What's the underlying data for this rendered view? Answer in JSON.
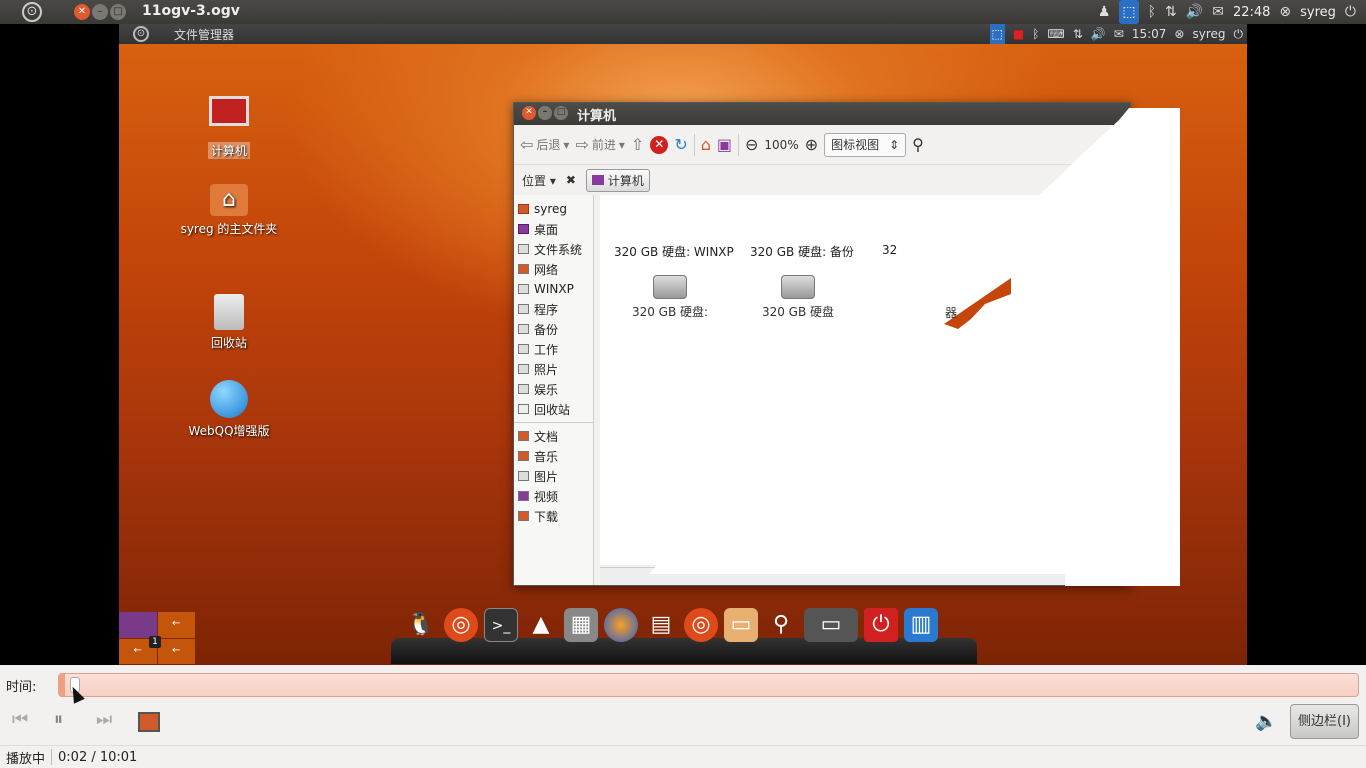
{
  "outer_panel": {
    "title": "11ogv-3.ogv",
    "time": "22:48",
    "user": "syreg"
  },
  "inner_panel": {
    "title": "文件管理器",
    "time": "15:07",
    "user": "syreg"
  },
  "desktop_icons": [
    {
      "label": "计算机",
      "icon": "computer-icon"
    },
    {
      "label": "syreg 的主文件夹",
      "icon": "home-folder-icon"
    },
    {
      "label": "回收站",
      "icon": "trash-icon"
    },
    {
      "label": "WebQQ增强版",
      "icon": "webqq-icon"
    }
  ],
  "file_manager": {
    "title": "计算机",
    "toolbar": {
      "back": "后退",
      "forward": "前进",
      "zoom": "100%",
      "view": "图标视图"
    },
    "location_label": "位置",
    "breadcrumb": "计算机",
    "sidebar": [
      "syreg",
      "桌面",
      "文件系统",
      "网络",
      "WINXP",
      "程序",
      "备份",
      "工作",
      "照片",
      "娱乐",
      "回收站"
    ],
    "sidebar_bookmarks": [
      "文档",
      "音乐",
      "图片",
      "视频",
      "下载"
    ],
    "drive_labels_top": [
      "320 GB 硬盘: WINXP",
      "320 GB 硬盘: 备份",
      "32"
    ],
    "drive_labels_bottom": [
      "320 GB 硬盘:",
      "320 GB 硬盘"
    ],
    "partial_label": "器"
  },
  "workspace": {
    "number": "1"
  },
  "controls": {
    "time_label": "时间:",
    "progress": 0.0033,
    "sidebar_button": "侧边栏(I)"
  },
  "status": {
    "state": "播放中",
    "position": "0:02 / 10:01"
  }
}
